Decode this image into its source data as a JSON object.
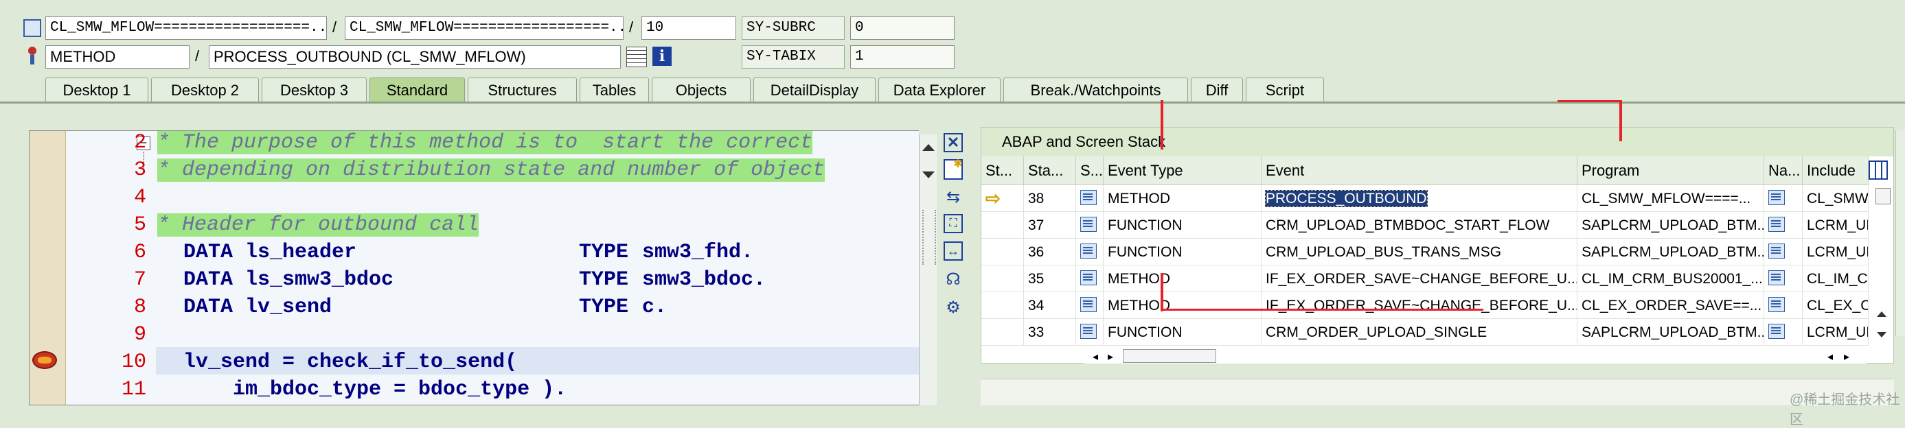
{
  "header": {
    "row1": {
      "class1": "CL_SMW_MFLOW==================...",
      "class2": "CL_SMW_MFLOW==================...",
      "line": "10",
      "sys_label": "SY-SUBRC",
      "sys_value": "0"
    },
    "row2": {
      "type": "METHOD",
      "name": "PROCESS_OUTBOUND (CL_SMW_MFLOW)",
      "sys_label": "SY-TABIX",
      "sys_value": "1"
    },
    "slash": "/"
  },
  "tabs": [
    "Desktop 1",
    "Desktop 2",
    "Desktop 3",
    "Standard",
    "Structures",
    "Tables",
    "Objects",
    "DetailDisplay",
    "Data Explorer",
    "Break./Watchpoints",
    "Diff",
    "Script"
  ],
  "active_tab": "Standard",
  "editor": {
    "lines": [
      {
        "num": "2",
        "text": "* The purpose of this method is to  start the correct"
      },
      {
        "num": "3",
        "text": "* depending on distribution state and number of object"
      },
      {
        "num": "4",
        "text": ""
      },
      {
        "num": "5",
        "text": "* Header for outbound call"
      },
      {
        "num": "6",
        "kw": "DATA",
        "name": "ls_header",
        "type_kw": "TYPE",
        "type": "smw3_fhd."
      },
      {
        "num": "7",
        "kw": "DATA",
        "name": "ls_smw3_bdoc",
        "type_kw": "TYPE",
        "type": "smw3_bdoc."
      },
      {
        "num": "8",
        "kw": "DATA",
        "name": "lv_send",
        "type_kw": "TYPE",
        "type": "c."
      },
      {
        "num": "9",
        "text": ""
      },
      {
        "num": "10",
        "text": "lv_send = check_if_to_send("
      },
      {
        "num": "11",
        "text": "    im_bdoc_type = bdoc_type )."
      }
    ]
  },
  "stack": {
    "title": "ABAP and Screen Stack",
    "headers": [
      "St...",
      "Sta...",
      "S...",
      "Event Type",
      "Event",
      "Program",
      "Na...",
      "Include"
    ],
    "rows": [
      {
        "level": "38",
        "type": "METHOD",
        "event": "PROCESS_OUTBOUND",
        "program": "CL_SMW_MFLOW====...",
        "include": "CL_SMW_M"
      },
      {
        "level": "37",
        "type": "FUNCTION",
        "event": "CRM_UPLOAD_BTMBDOC_START_FLOW",
        "program": "SAPLCRM_UPLOAD_BTM...",
        "include": "LCRM_UPLC"
      },
      {
        "level": "36",
        "type": "FUNCTION",
        "event": "CRM_UPLOAD_BUS_TRANS_MSG",
        "program": "SAPLCRM_UPLOAD_BTM...",
        "include": "LCRM_UPLC"
      },
      {
        "level": "35",
        "type": "METHOD",
        "event": "IF_EX_ORDER_SAVE~CHANGE_BEFORE_U...",
        "program": "CL_IM_CRM_BUS20001_...",
        "include": "CL_IM_CRM"
      },
      {
        "level": "34",
        "type": "METHOD",
        "event": "IF_EX_ORDER_SAVE~CHANGE_BEFORE_U...",
        "program": "CL_EX_ORDER_SAVE==...",
        "include": "CL_EX_ORD"
      },
      {
        "level": "33",
        "type": "FUNCTION",
        "event": "CRM_ORDER_UPLOAD_SINGLE",
        "program": "SAPLCRM_UPLOAD_BTM...",
        "include": "LCRM_UPLC"
      }
    ]
  },
  "watermark": "@稀土掘金技术社区"
}
